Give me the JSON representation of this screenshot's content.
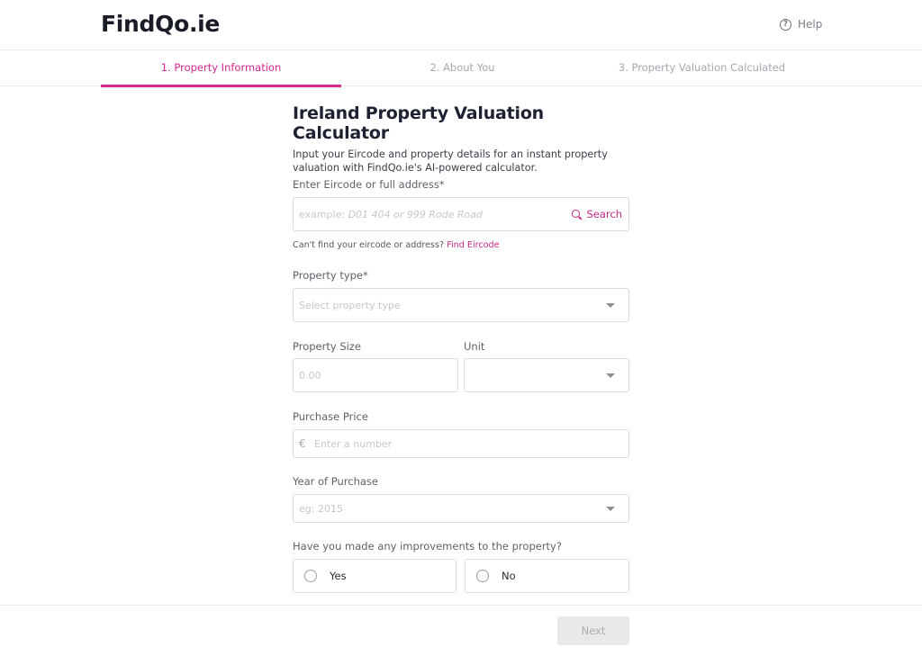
{
  "header": {
    "logo": "FindQo.ie",
    "help_label": "Help",
    "help_icon": "question-circle-icon"
  },
  "steps": [
    {
      "label": "1. Property Information",
      "active": true
    },
    {
      "label": "2. About You",
      "active": false
    },
    {
      "label": "3. Property Valuation Calculated",
      "active": false
    }
  ],
  "form": {
    "title": "Ireland Property Valuation Calculator",
    "subtitle": "Input your Eircode and property details for an instant property valuation with FindQo.ie's AI-powered calculator.",
    "address": {
      "label": "Enter Eircode or full address*",
      "placeholder_prefix": "example: ",
      "placeholder_example": "D01 404 or 999 Rode Road",
      "value": "",
      "search_label": "Search",
      "search_icon": "search-icon",
      "help_text": "Can't find your eircode or address?",
      "help_link": "Find Eircode"
    },
    "property_type": {
      "label": "Property type*",
      "placeholder": "Select property type",
      "value": ""
    },
    "property_size": {
      "label": "Property Size",
      "placeholder": "0.00",
      "value": ""
    },
    "unit": {
      "label": "Unit",
      "value": ""
    },
    "purchase_price": {
      "label": "Purchase Price",
      "currency_symbol": "€",
      "placeholder": "Enter a number",
      "value": ""
    },
    "year_of_purchase": {
      "label": "Year of Purchase",
      "placeholder": "eg: 2015",
      "value": ""
    },
    "improvements": {
      "label": "Have you made any improvements to the property?",
      "options": [
        {
          "label": "Yes",
          "selected": false
        },
        {
          "label": "No",
          "selected": false
        }
      ]
    }
  },
  "footer": {
    "next_label": "Next",
    "next_disabled": true
  },
  "colors": {
    "accent": "#d72c8e",
    "text_dark": "#1d2130",
    "border": "#dcdcdc",
    "disabled_bg": "#e9e9ea"
  }
}
